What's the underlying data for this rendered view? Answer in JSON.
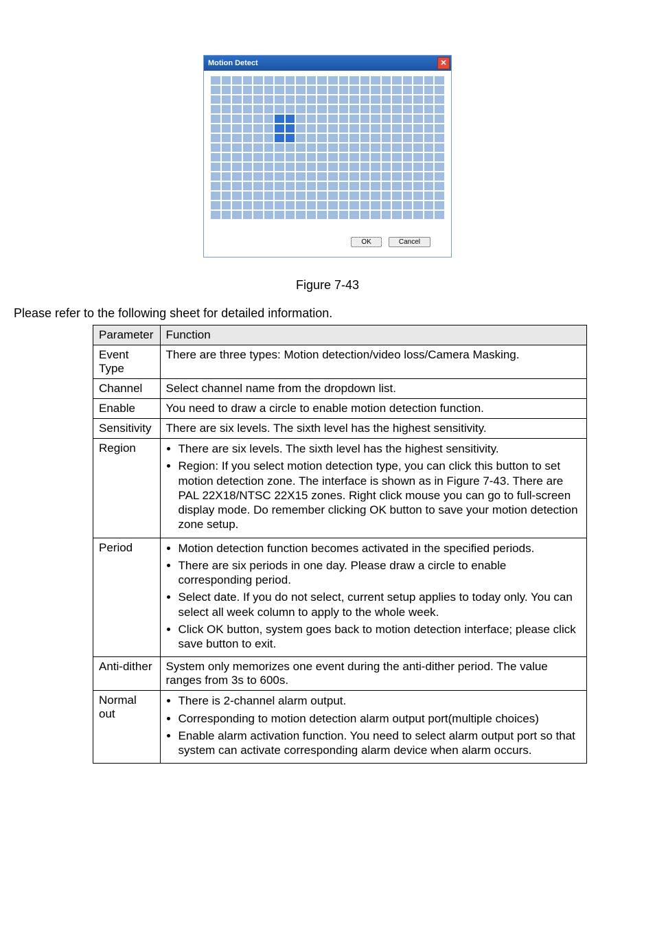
{
  "dialog": {
    "title": "Motion Detect",
    "close_glyph": "✕",
    "ok_label": "OK",
    "cancel_label": "Cancel",
    "grid_cols": 22,
    "grid_rows": 15,
    "selected_cells": [
      {
        "r": 4,
        "c": 6
      },
      {
        "r": 4,
        "c": 7
      },
      {
        "r": 5,
        "c": 6
      },
      {
        "r": 5,
        "c": 7
      },
      {
        "r": 6,
        "c": 6
      },
      {
        "r": 6,
        "c": 7
      }
    ]
  },
  "figure_caption": "Figure 7-43",
  "intro_text": "Please refer to the following sheet for detailed information.",
  "table": {
    "head": {
      "col1": "Parameter",
      "col2": "Function"
    },
    "rows": [
      {
        "name": "Event Type",
        "plain": "There are three types: Motion detection/video loss/Camera Masking."
      },
      {
        "name": "Channel",
        "plain": "Select channel name from the dropdown list."
      },
      {
        "name": "Enable",
        "plain": "You need to draw a circle to enable motion detection function."
      },
      {
        "name": "Sensitivity",
        "plain": "There are six levels.  The sixth level has the highest sensitivity."
      },
      {
        "name": "Region",
        "bullets": [
          "There are six levels.  The sixth level has the highest sensitivity.",
          "Region: If you select motion detection type, you can click this button to set motion detection zone.  The interface is shown as in Figure 7-43. There are PAL 22X18/NTSC 22X15 zones. Right click mouse you can go to full-screen display mode. Do remember clicking OK button to save your motion detection zone setup."
        ]
      },
      {
        "name": "Period",
        "bullets": [
          "Motion detection function becomes activated in the specified periods.",
          "There are six periods in one day. Please draw a circle to enable corresponding period.",
          "Select date. If you do not select, current setup applies to today only. You can select all week column to apply to the whole week.",
          "Click OK button, system goes back to motion detection interface; please click save button to exit."
        ]
      },
      {
        "name": "Anti-dither",
        "plain": "System only memorizes one event during the anti-dither period. The value ranges from 3s to 600s."
      },
      {
        "name": "Normal out",
        "bullets": [
          "There is 2-channel alarm output.",
          "Corresponding to motion detection alarm output port(multiple choices)",
          "Enable alarm activation function. You need to select alarm output port so that system can activate corresponding alarm device when alarm occurs."
        ]
      }
    ]
  }
}
